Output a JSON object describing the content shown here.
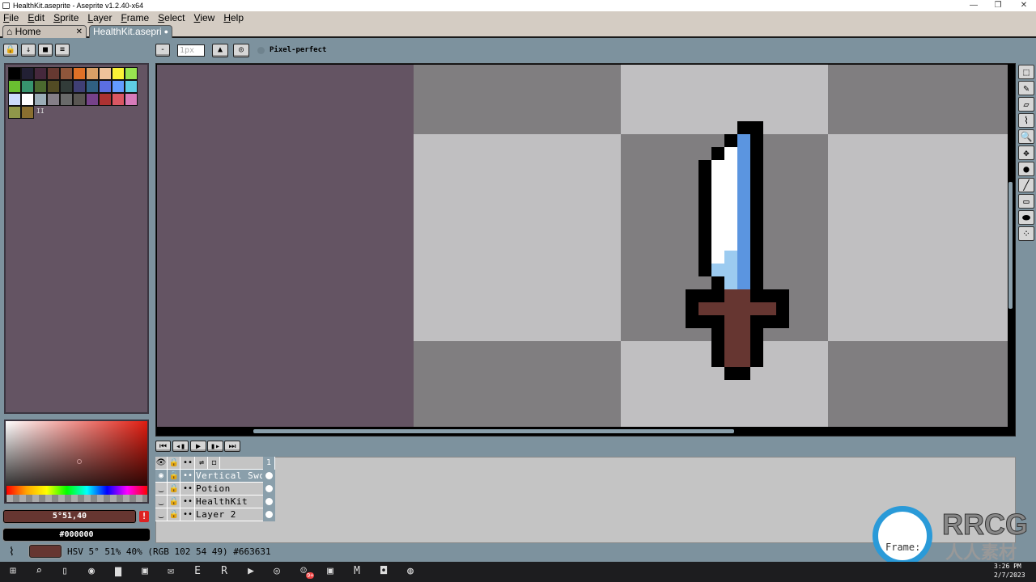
{
  "window": {
    "title": "HealthKit.aseprite - Aseprite v1.2.40-x64",
    "controls": [
      "—",
      "❐",
      "✕"
    ]
  },
  "menu": [
    "File",
    "Edit",
    "Sprite",
    "Layer",
    "Frame",
    "Select",
    "View",
    "Help"
  ],
  "tabs": [
    {
      "label": "Home",
      "icon": "home-icon",
      "close": "✕"
    },
    {
      "label": "HealthKit.asepri",
      "modified": "●"
    }
  ],
  "palette_toolbar": [
    "🔒",
    "↓",
    "■",
    "≡"
  ],
  "context_bar": {
    "minus": "-",
    "brush_size": "1px",
    "pixel_perfect": "Pixel-perfect"
  },
  "palette": {
    "colors": [
      "#000000",
      "#222034",
      "#45283c",
      "#663931",
      "#8f563b",
      "#df7126",
      "#d9a066",
      "#eec39a",
      "#fbf236",
      "#99e550",
      "#6abe30",
      "#37946e",
      "#4b692f",
      "#524b24",
      "#323c39",
      "#3f3f74",
      "#306082",
      "#5b6ee1",
      "#639bff",
      "#5fcde4",
      "#cbdbfc",
      "#ffffff",
      "#9badb7",
      "#847e87",
      "#696a6a",
      "#595652",
      "#76428a",
      "#ac3232",
      "#d95763",
      "#d77bba",
      "#8f974a",
      "#8a6f30"
    ],
    "more": "II"
  },
  "colors": {
    "foreground_label": "5°51,40",
    "background_label": "#000000",
    "foreground": "#663631",
    "background": "#000000",
    "warning": "!"
  },
  "status": {
    "text": "HSV 5° 51% 40% (RGB 102 54 49) #663631"
  },
  "sprite": {
    "palette": {
      "k": "#000000",
      "b": "#5b95e0",
      "w": "#ffffff",
      "l": "#9ccbf0",
      "r": "#663631"
    },
    "rows": [
      "....kk..",
      "...kbk..",
      "..kwbk..",
      ".kwwbk..",
      ".kwwbk..",
      ".kwwbk..",
      ".kwwbk..",
      ".kwwbk..",
      ".kwwbk..",
      ".kwwbk..",
      ".kwlbk..",
      ".kllbk..",
      "..klbk..",
      "kkkrrkkk",
      "krrrrrrk",
      "kkkrrkkk",
      "..krrk..",
      "..krrk..",
      "..krrk..",
      "...kk..."
    ]
  },
  "tools": [
    "selection-icon",
    "pencil-icon",
    "eraser-icon",
    "eyedropper-icon",
    "zoom-icon",
    "move-icon",
    "fill-icon",
    "line-icon",
    "rectangle-icon",
    "blob-icon",
    "spray-icon"
  ],
  "tool_glyphs": [
    "⬚",
    "✎",
    "▱",
    "⌇",
    "🔍",
    "✥",
    "●",
    "╱",
    "▭",
    "⬬",
    "⁘"
  ],
  "timeline": {
    "buttons": [
      "⏮",
      "◂▮",
      "▶",
      "▮▸",
      "⏭"
    ],
    "header_icons": [
      "👁",
      "🔒",
      "••",
      "⇌",
      "◻"
    ],
    "frame": "1",
    "layers": [
      {
        "name": "Vertical Sword",
        "visible": true,
        "selected": true
      },
      {
        "name": "Potion",
        "visible": false
      },
      {
        "name": "HealthKit",
        "visible": false
      },
      {
        "name": "Layer 2",
        "visible": false
      }
    ]
  },
  "watermark": {
    "brand": "RRCG",
    "sub": "人人素材",
    "frame_text": "Frame:"
  },
  "taskbar": {
    "time": "3:26 PM",
    "date": "2/7/2023",
    "badge": "9+",
    "icons": [
      "windows-icon",
      "search-icon",
      "task-view-icon",
      "edge-icon",
      "file-explorer-icon",
      "store-icon",
      "mail-icon",
      "epic-games-icon",
      "rsi-icon",
      "media-icon",
      "steam-icon",
      "discord-icon",
      "aseprite-icon",
      "miro-icon",
      "app-icon",
      "chrome-icon"
    ],
    "glyphs": [
      "⊞",
      "⌕",
      "▯",
      "◉",
      "▆",
      "▣",
      "✉",
      "E",
      "R",
      "▶",
      "◎",
      "☺",
      "▣",
      "M",
      "◘",
      "◍"
    ]
  }
}
